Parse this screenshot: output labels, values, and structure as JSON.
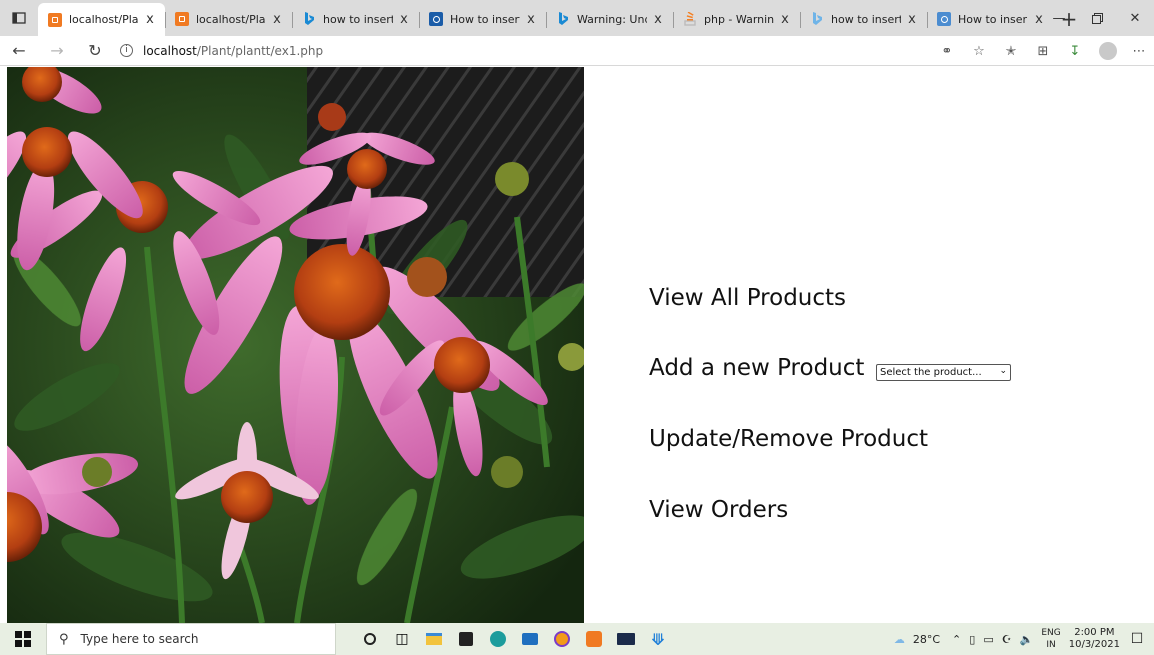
{
  "browser": {
    "tabs": [
      {
        "title": "localhost/Plan",
        "icon": "xampp-icon",
        "color": "#f07a22",
        "active": true
      },
      {
        "title": "localhost/Plan",
        "icon": "xampp-icon",
        "color": "#f07a22",
        "active": false
      },
      {
        "title": "how to insert",
        "icon": "bing-icon",
        "color": "#1a8ad4",
        "active": false
      },
      {
        "title": "How to insert",
        "icon": "stackoverflow-icon",
        "color": "#1a5ca8",
        "active": false
      },
      {
        "title": "Warning: Und",
        "icon": "bing-icon",
        "color": "#1a8ad4",
        "active": false
      },
      {
        "title": "php - Warnin",
        "icon": "stackoverflow-icon",
        "color": "#f48024",
        "active": false
      },
      {
        "title": "how to insert",
        "icon": "bing-icon",
        "color": "#6fb4e8",
        "active": false
      },
      {
        "title": "How to inser",
        "icon": "stackoverflow-icon",
        "color": "#4b8cd0",
        "active": false
      }
    ],
    "tab_close_glyph": "x",
    "new_tab_glyph": "+",
    "url_host": "localhost",
    "url_path": "/Plant/plantt/ex1.php"
  },
  "page": {
    "menu": [
      {
        "label": "View All Products"
      },
      {
        "label": "Add a new Product"
      },
      {
        "label": "Update/Remove Product"
      },
      {
        "label": "View Orders"
      }
    ],
    "product_select": {
      "selected": "Select the product..."
    }
  },
  "taskbar": {
    "search_placeholder": "Type here to search",
    "temperature": "28°C",
    "lang_line1": "ENG",
    "lang_line2": "IN",
    "time": "2:00 PM",
    "date": "10/3/2021"
  }
}
